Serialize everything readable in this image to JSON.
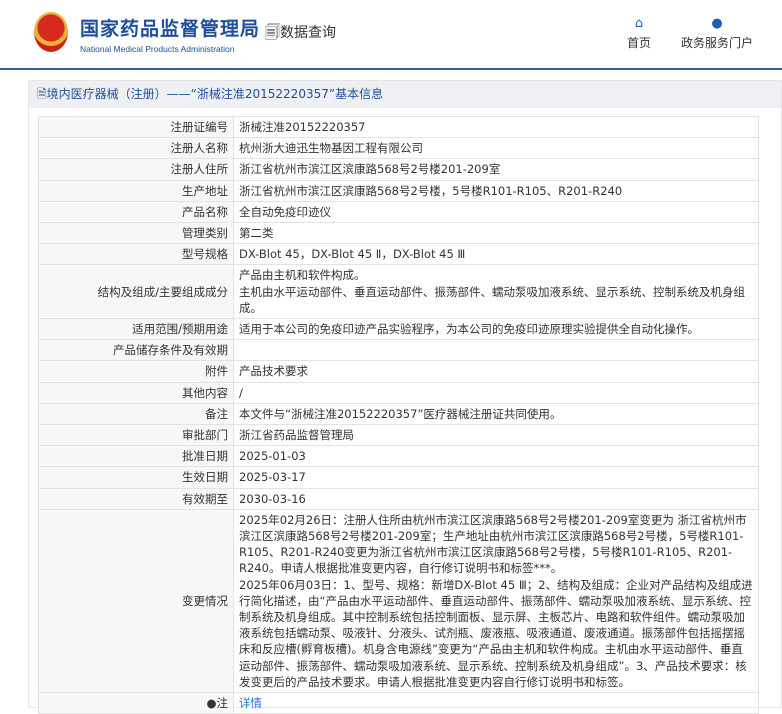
{
  "header": {
    "title_cn": "国家药品监督管理局",
    "title_en": "National Medical Products Administration",
    "query": "数据查询",
    "nav": [
      {
        "label": "首页",
        "icon": "home-icon"
      },
      {
        "label": "政务服务门户",
        "icon": "user-icon"
      }
    ]
  },
  "panel": {
    "title": "境内医疗器械（注册）——“浙械注准20152220357”基本信息"
  },
  "rows": [
    {
      "label": "注册证编号",
      "value": "浙械注准20152220357"
    },
    {
      "label": "注册人名称",
      "value": "杭州浙大迪迅生物基因工程有限公司"
    },
    {
      "label": "注册人住所",
      "value": "浙江省杭州市滨江区滨康路568号2号楼201-209室"
    },
    {
      "label": "生产地址",
      "value": "浙江省杭州市滨江区滨康路568号2号楼，5号楼R101-R105、R201-R240"
    },
    {
      "label": "产品名称",
      "value": "全自动免疫印迹仪"
    },
    {
      "label": "管理类别",
      "value": "第二类"
    },
    {
      "label": "型号规格",
      "value": "DX-Blot 45，DX-Blot 45 Ⅱ，DX-Blot 45 Ⅲ"
    },
    {
      "label": "结构及组成/主要组成成分",
      "value": "产品由主机和软件构成。\n主机由水平运动部件、垂直运动部件、振荡部件、蠕动泵吸加液系统、显示系统、控制系统及机身组成。"
    },
    {
      "label": "适用范围/预期用途",
      "value": "适用于本公司的免疫印迹产品实验程序，为本公司的免疫印迹原理实验提供全自动化操作。"
    },
    {
      "label": "产品储存条件及有效期",
      "value": ""
    },
    {
      "label": "附件",
      "value": "产品技术要求"
    },
    {
      "label": "其他内容",
      "value": "/"
    },
    {
      "label": "备注",
      "value": "本文件与“浙械注准20152220357”医疗器械注册证共同使用。"
    },
    {
      "label": "审批部门",
      "value": "浙江省药品监督管理局"
    },
    {
      "label": "批准日期",
      "value": "2025-01-03"
    },
    {
      "label": "生效日期",
      "value": "2025-03-17"
    },
    {
      "label": "有效期至",
      "value": "2030-03-16"
    },
    {
      "label": "变更情况",
      "value": "2025年02月26日：注册人住所由杭州市滨江区滨康路568号2号楼201-209室变更为 浙江省杭州市滨江区滨康路568号2号楼201-209室；生产地址由杭州市滨江区滨康路568号2号楼，5号楼R101-R105、R201-R240变更为浙江省杭州市滨江区滨康路568号2号楼，5号楼R101-R105、R201-R240。申请人根据批准变更内容，自行修订说明书和标签***。\n2025年06月03日：1、型号、规格：新增DX-Blot 45 Ⅲ；2、结构及组成：企业对产品结构及组成进行简化描述，由“产品由水平运动部件、垂直运动部件、振荡部件、蠕动泵吸加液系统、显示系统、控制系统及机身组成。其中控制系统包括控制面板、显示屏、主板芯片、电路和软件组件。蠕动泵吸加液系统包括蠕动泵、吸液针、分液头、试剂瓶、废液瓶、吸液通道、废液通道。振荡部件包括摇摆摇床和反应槽(孵育板槽)。机身含电源线”变更为“产品由主机和软件构成。主机由水平运动部件、垂直运动部件、振荡部件、蠕动泵吸加液系统、显示系统、控制系统及机身组成”。3、产品技术要求：核发变更后的产品技术要求。申请人根据批准变更内容自行修订说明书和标签。"
    }
  ],
  "note": {
    "label": "注",
    "link": "详情"
  }
}
